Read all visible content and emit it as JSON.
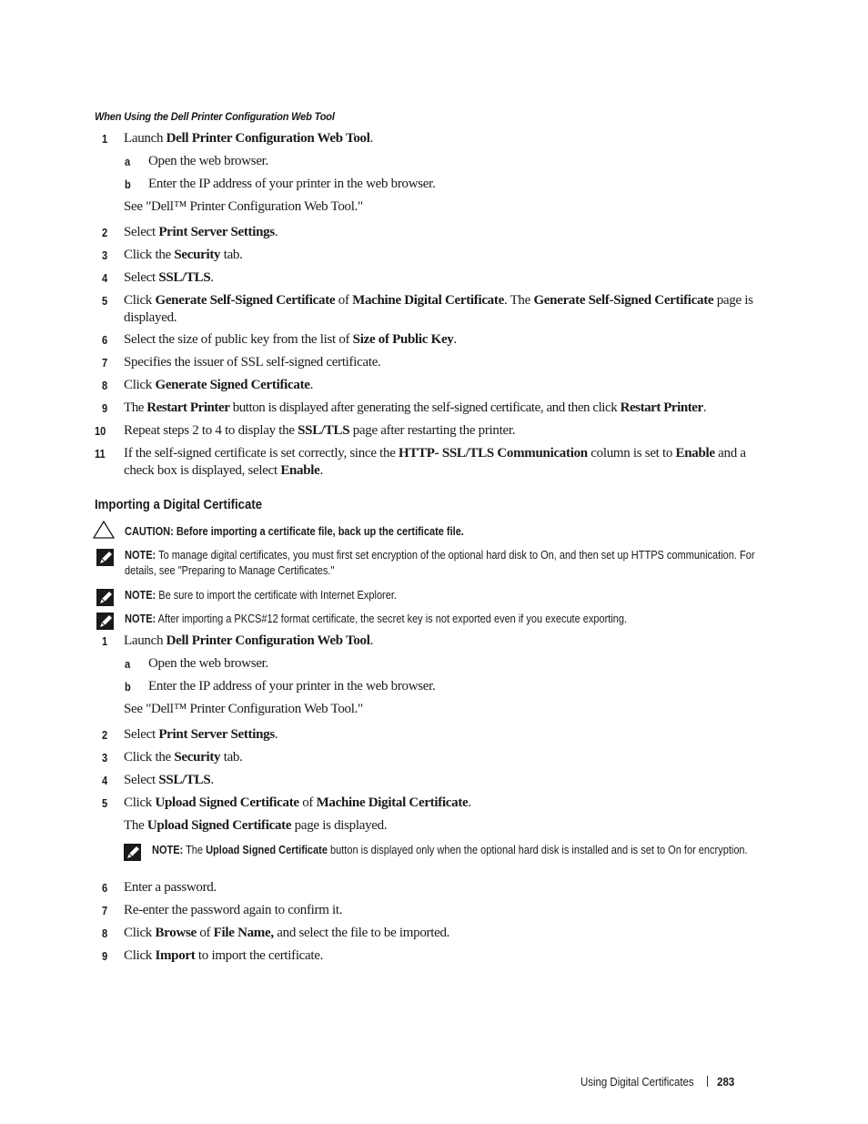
{
  "section1": {
    "subheading": "When Using the Dell Printer Configuration Web Tool",
    "steps": [
      {
        "num": "1",
        "pre": "Launch ",
        "b1": "Dell Printer Configuration Web Tool",
        "post": "."
      },
      {
        "num": "a",
        "text": "Open the web browser."
      },
      {
        "num": "b",
        "text": "Enter the IP address of your printer in the web browser."
      },
      {
        "text": "See \"Dell™ Printer Configuration Web Tool.\""
      },
      {
        "num": "2",
        "pre": "Select ",
        "b1": "Print Server Settings",
        "post": "."
      },
      {
        "num": "3",
        "pre": "Click the ",
        "b1": "Security",
        "post": " tab."
      },
      {
        "num": "4",
        "pre": "Select ",
        "b1": "SSL/TLS",
        "post": "."
      },
      {
        "num": "5",
        "pre": "Click ",
        "b1": "Generate Self-Signed Certificate",
        "mid1": " of ",
        "b2": "Machine Digital Certificate",
        "mid2": ". The ",
        "b3": "Generate Self-Signed Certificate",
        "post": " page is displayed."
      },
      {
        "num": "6",
        "pre": "Select the size of public key from the list of ",
        "b1": "Size of Public Key",
        "post": "."
      },
      {
        "num": "7",
        "text": "Specifies the issuer of SSL self-signed certificate."
      },
      {
        "num": "8",
        "pre": "Click ",
        "b1": "Generate Signed Certificate",
        "post": "."
      },
      {
        "num": "9",
        "pre": "The ",
        "b1": "Restart Printer",
        "mid1": " button is displayed after generating the self-signed certificate, and then click ",
        "b2": "Restart Printer",
        "post": "."
      },
      {
        "num": "10",
        "pre": "Repeat steps 2 to 4 to display the ",
        "b1": "SSL/TLS",
        "post": " page after restarting the printer."
      },
      {
        "num": "11",
        "pre": "If the self-signed certificate is set correctly, since the ",
        "b1": "HTTP- SSL/TLS Communication",
        "mid1": " column is set to ",
        "b2": "Enable",
        "mid2": " and a check box is displayed, select ",
        "b3": "Enable",
        "post": "."
      }
    ]
  },
  "section2": {
    "heading": "Importing a Digital Certificate",
    "caution": {
      "label": "CAUTION:",
      "text": " Before importing a certificate file, back up the certificate file."
    },
    "notes": [
      {
        "label": "NOTE:",
        "text": " To manage digital certificates, you must first set encryption of the optional hard disk to On, and then set up HTTPS communication. For details, see \"Preparing to Manage Certificates.\""
      },
      {
        "label": "NOTE:",
        "text": " Be sure to import the certificate with Internet Explorer."
      },
      {
        "label": "NOTE:",
        "text": " After importing a PKCS#12 format certificate, the secret key is not exported even if you execute exporting."
      }
    ],
    "steps": [
      {
        "num": "1",
        "pre": "Launch ",
        "b1": "Dell Printer Configuration Web Tool",
        "post": "."
      },
      {
        "num": "a",
        "text": "Open the web browser."
      },
      {
        "num": "b",
        "text": "Enter the IP address of your printer in the web browser."
      },
      {
        "text": "See \"Dell™ Printer Configuration Web Tool.\""
      },
      {
        "num": "2",
        "pre": "Select ",
        "b1": "Print Server Settings",
        "post": "."
      },
      {
        "num": "3",
        "pre": "Click the ",
        "b1": "Security",
        "post": " tab."
      },
      {
        "num": "4",
        "pre": "Select ",
        "b1": "SSL/TLS",
        "post": "."
      },
      {
        "num": "5",
        "pre": "Click ",
        "b1": "Upload Signed Certificate",
        "mid1": " of ",
        "b2": "Machine Digital Certificate",
        "post": "."
      },
      {
        "pre": "The ",
        "b1": "Upload Signed Certificate",
        "post": " page is displayed."
      },
      {
        "num": "6",
        "text": "Enter a password."
      },
      {
        "num": "7",
        "text": "Re-enter the password again to confirm it."
      },
      {
        "num": "8",
        "pre": "Click ",
        "b1": "Browse",
        "mid1": " of ",
        "b2": "File Name,",
        "post": " and select the file to be imported."
      },
      {
        "num": "9",
        "pre": "Click ",
        "b1": "Import",
        "post": " to import the certificate."
      }
    ],
    "inline_note": {
      "label": "NOTE:",
      "pre": " The ",
      "b1": "Upload Signed Certificate",
      "post": " button is displayed only when the optional hard disk is installed and is set to On for encryption."
    }
  },
  "footer": {
    "chapter": "Using Digital Certificates",
    "page_number": "283"
  }
}
